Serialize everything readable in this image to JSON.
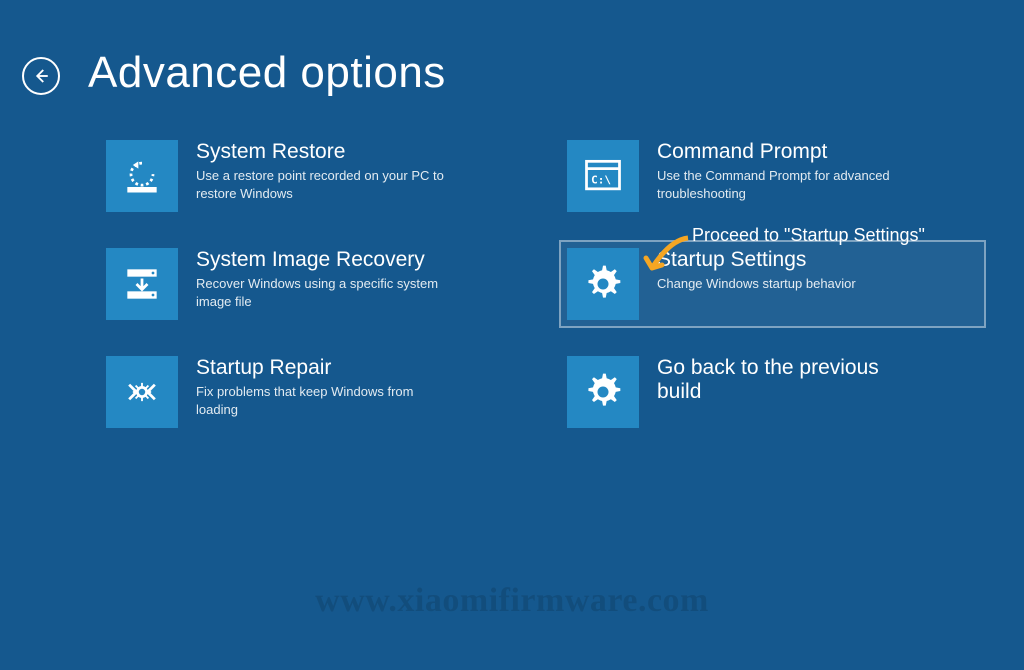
{
  "page_title": "Advanced options",
  "callout_text": "Proceed to \"Startup Settings\"",
  "watermark": "www.xiaomifirmware.com",
  "tiles": [
    {
      "title": "System Restore",
      "desc": "Use a restore point recorded on your PC to restore Windows"
    },
    {
      "title": "Command Prompt",
      "desc": "Use the Command Prompt for advanced troubleshooting"
    },
    {
      "title": "System Image Recovery",
      "desc": "Recover Windows using a specific system image file"
    },
    {
      "title": "Startup Settings",
      "desc": "Change Windows startup behavior"
    },
    {
      "title": "Startup Repair",
      "desc": "Fix problems that keep Windows from loading"
    },
    {
      "title": "Go back to the previous build",
      "desc": ""
    }
  ]
}
